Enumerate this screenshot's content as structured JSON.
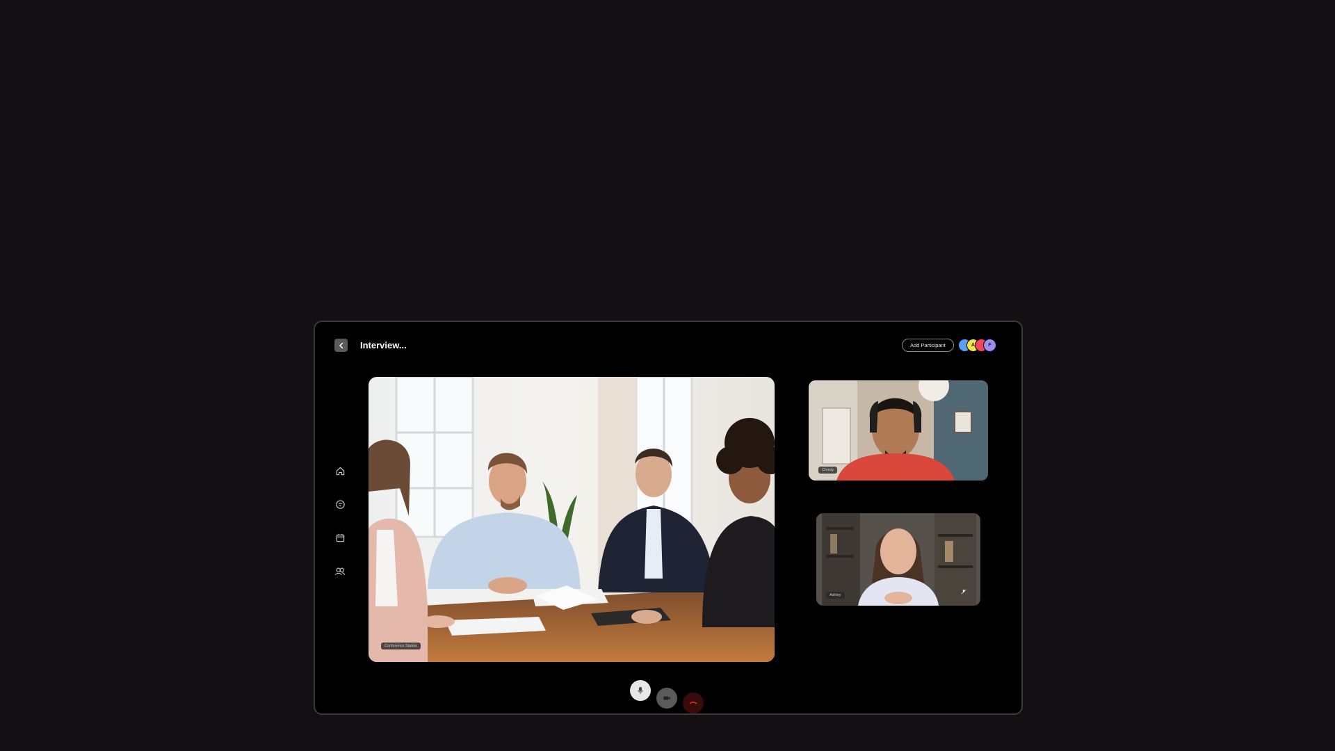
{
  "header": {
    "title": "Interview...",
    "add_participant_label": "Add Participant"
  },
  "avatars": [
    {
      "initial": "",
      "color": "#5aa0f5"
    },
    {
      "initial": "A",
      "color": "#f3e34c"
    },
    {
      "initial": "",
      "color": "#f0475d"
    },
    {
      "initial": "F",
      "color": "#9b90f0"
    }
  ],
  "sidebar": {
    "items": [
      {
        "icon": "home-icon"
      },
      {
        "icon": "chat-icon"
      },
      {
        "icon": "calendar-icon"
      },
      {
        "icon": "users-icon"
      }
    ]
  },
  "main_video": {
    "label": "Conference Station"
  },
  "participants": [
    {
      "name": "Christy"
    },
    {
      "name": "Ashley"
    }
  ],
  "controls": {
    "mic": "microphone-icon",
    "camera": "camera-icon",
    "end": "end-call-icon"
  },
  "colors": {
    "background": "#140f12",
    "window": "#000000",
    "end_call": "#e0352f"
  }
}
